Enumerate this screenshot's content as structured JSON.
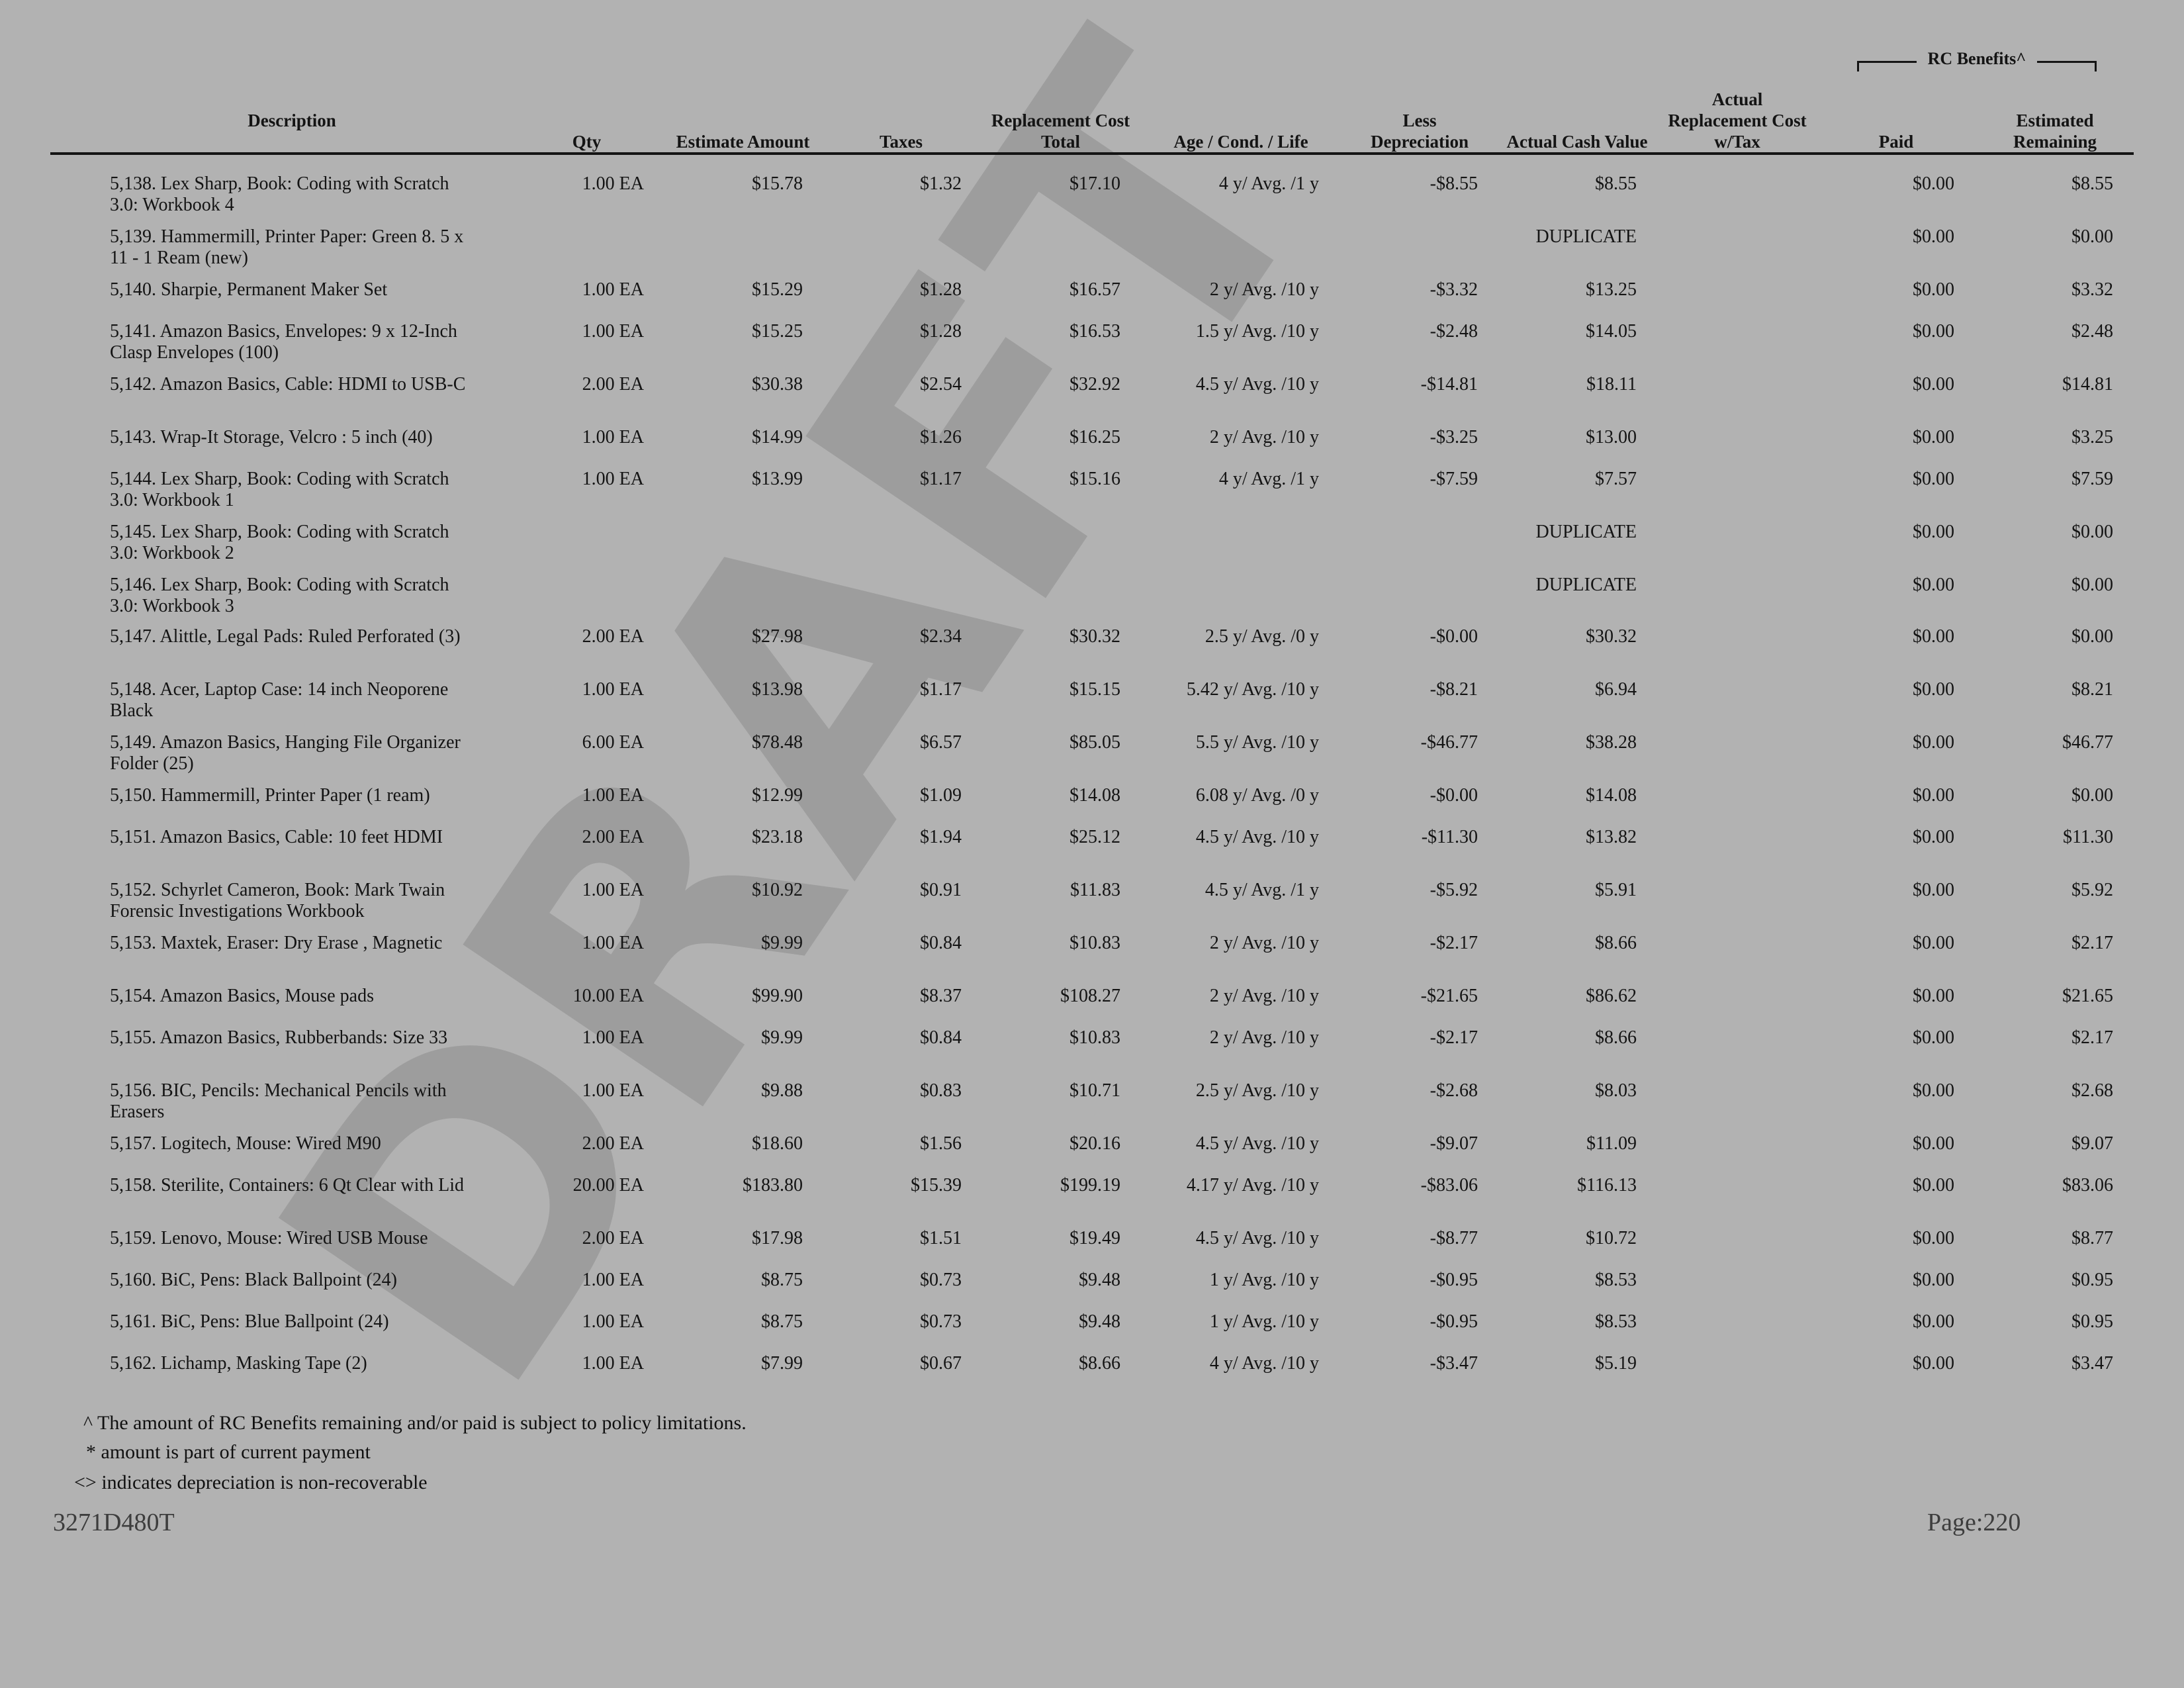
{
  "header": {
    "rc_benefits": "RC Benefits^",
    "description": "Description",
    "qty": "Qty",
    "estimate_amount": "Estimate Amount",
    "taxes": "Taxes",
    "rc_total_1": "Replacement Cost",
    "rc_total_2": "Total",
    "age_cond_life": "Age / Cond. / Life",
    "less_dep_1": "Less",
    "less_dep_2": "Depreciation",
    "acv": "Actual Cash Value",
    "arc_1": "Actual",
    "arc_2": "Replacement Cost",
    "arc_3": "w/Tax",
    "paid": "Paid",
    "est_rem_1": "Estimated",
    "est_rem_2": "Remaining"
  },
  "rows": [
    {
      "desc": "5,138. Lex Sharp, Book: Coding with Scratch 3.0: Workbook 4",
      "qty": "1.00 EA",
      "est": "$15.78",
      "tax": "$1.32",
      "rct": "$17.10",
      "age": "4 y/ Avg. /1 y",
      "dep": "-$8.55",
      "acv": "$8.55",
      "arc": "",
      "paid": "$0.00",
      "rem": "$8.55"
    },
    {
      "desc": "5,139. Hammermill, Printer Paper: Green 8. 5 x 11 - 1 Ream (new)",
      "qty": "",
      "est": "",
      "tax": "",
      "rct": "",
      "age": "",
      "dep": "",
      "acv": "DUPLICATE",
      "arc": "",
      "paid": "$0.00",
      "rem": "$0.00"
    },
    {
      "desc": "5,140. Sharpie, Permanent Maker Set",
      "qty": "1.00 EA",
      "est": "$15.29",
      "tax": "$1.28",
      "rct": "$16.57",
      "age": "2 y/ Avg. /10 y",
      "dep": "-$3.32",
      "acv": "$13.25",
      "arc": "",
      "paid": "$0.00",
      "rem": "$3.32"
    },
    {
      "desc": "5,141. Amazon Basics, Envelopes: 9 x 12-Inch Clasp Envelopes (100)",
      "qty": "1.00 EA",
      "est": "$15.25",
      "tax": "$1.28",
      "rct": "$16.53",
      "age": "1.5 y/ Avg. /10 y",
      "dep": "-$2.48",
      "acv": "$14.05",
      "arc": "",
      "paid": "$0.00",
      "rem": "$2.48"
    },
    {
      "desc": "5,142. Amazon Basics, Cable: HDMI to USB-C",
      "qty": "2.00 EA",
      "est": "$30.38",
      "tax": "$2.54",
      "rct": "$32.92",
      "age": "4.5 y/ Avg. /10 y",
      "dep": "-$14.81",
      "acv": "$18.11",
      "arc": "",
      "paid": "$0.00",
      "rem": "$14.81"
    },
    {
      "desc": "5,143. Wrap-It Storage, Velcro : 5 inch (40)",
      "qty": "1.00 EA",
      "est": "$14.99",
      "tax": "$1.26",
      "rct": "$16.25",
      "age": "2 y/ Avg. /10 y",
      "dep": "-$3.25",
      "acv": "$13.00",
      "arc": "",
      "paid": "$0.00",
      "rem": "$3.25"
    },
    {
      "desc": "5,144. Lex Sharp, Book: Coding with Scratch 3.0: Workbook 1",
      "qty": "1.00 EA",
      "est": "$13.99",
      "tax": "$1.17",
      "rct": "$15.16",
      "age": "4 y/ Avg. /1 y",
      "dep": "-$7.59",
      "acv": "$7.57",
      "arc": "",
      "paid": "$0.00",
      "rem": "$7.59"
    },
    {
      "desc": "5,145. Lex Sharp, Book: Coding with Scratch 3.0: Workbook 2",
      "qty": "",
      "est": "",
      "tax": "",
      "rct": "",
      "age": "",
      "dep": "",
      "acv": "DUPLICATE",
      "arc": "",
      "paid": "$0.00",
      "rem": "$0.00"
    },
    {
      "desc": "5,146. Lex Sharp, Book: Coding with Scratch 3.0: Workbook 3",
      "qty": "",
      "est": "",
      "tax": "",
      "rct": "",
      "age": "",
      "dep": "",
      "acv": "DUPLICATE",
      "arc": "",
      "paid": "$0.00",
      "rem": "$0.00"
    },
    {
      "desc": "5,147. Alittle, Legal Pads: Ruled Perforated (3)",
      "qty": "2.00 EA",
      "est": "$27.98",
      "tax": "$2.34",
      "rct": "$30.32",
      "age": "2.5 y/ Avg. /0 y",
      "dep": "-$0.00",
      "acv": "$30.32",
      "arc": "",
      "paid": "$0.00",
      "rem": "$0.00"
    },
    {
      "desc": "5,148. Acer, Laptop Case: 14 inch Neoporene Black",
      "qty": "1.00 EA",
      "est": "$13.98",
      "tax": "$1.17",
      "rct": "$15.15",
      "age": "5.42 y/ Avg. /10 y",
      "dep": "-$8.21",
      "acv": "$6.94",
      "arc": "",
      "paid": "$0.00",
      "rem": "$8.21"
    },
    {
      "desc": "5,149. Amazon Basics, Hanging File Organizer Folder (25)",
      "qty": "6.00 EA",
      "est": "$78.48",
      "tax": "$6.57",
      "rct": "$85.05",
      "age": "5.5 y/ Avg. /10 y",
      "dep": "-$46.77",
      "acv": "$38.28",
      "arc": "",
      "paid": "$0.00",
      "rem": "$46.77"
    },
    {
      "desc": "5,150. Hammermill, Printer Paper (1 ream)",
      "qty": "1.00 EA",
      "est": "$12.99",
      "tax": "$1.09",
      "rct": "$14.08",
      "age": "6.08 y/ Avg. /0 y",
      "dep": "-$0.00",
      "acv": "$14.08",
      "arc": "",
      "paid": "$0.00",
      "rem": "$0.00"
    },
    {
      "desc": "5,151. Amazon Basics, Cable: 10 feet HDMI",
      "qty": "2.00 EA",
      "est": "$23.18",
      "tax": "$1.94",
      "rct": "$25.12",
      "age": "4.5 y/ Avg. /10 y",
      "dep": "-$11.30",
      "acv": "$13.82",
      "arc": "",
      "paid": "$0.00",
      "rem": "$11.30"
    },
    {
      "desc": "5,152. Schyrlet Cameron, Book: Mark Twain Forensic Investigations Workbook",
      "qty": "1.00 EA",
      "est": "$10.92",
      "tax": "$0.91",
      "rct": "$11.83",
      "age": "4.5 y/ Avg. /1 y",
      "dep": "-$5.92",
      "acv": "$5.91",
      "arc": "",
      "paid": "$0.00",
      "rem": "$5.92"
    },
    {
      "desc": "5,153. Maxtek, Eraser: Dry Erase , Magnetic",
      "qty": "1.00 EA",
      "est": "$9.99",
      "tax": "$0.84",
      "rct": "$10.83",
      "age": "2 y/ Avg. /10 y",
      "dep": "-$2.17",
      "acv": "$8.66",
      "arc": "",
      "paid": "$0.00",
      "rem": "$2.17"
    },
    {
      "desc": "5,154. Amazon Basics, Mouse pads",
      "qty": "10.00 EA",
      "est": "$99.90",
      "tax": "$8.37",
      "rct": "$108.27",
      "age": "2 y/ Avg. /10 y",
      "dep": "-$21.65",
      "acv": "$86.62",
      "arc": "",
      "paid": "$0.00",
      "rem": "$21.65"
    },
    {
      "desc": "5,155. Amazon Basics, Rubberbands: Size 33",
      "qty": "1.00 EA",
      "est": "$9.99",
      "tax": "$0.84",
      "rct": "$10.83",
      "age": "2 y/ Avg. /10 y",
      "dep": "-$2.17",
      "acv": "$8.66",
      "arc": "",
      "paid": "$0.00",
      "rem": "$2.17"
    },
    {
      "desc": "5,156. BIC, Pencils: Mechanical Pencils with Erasers",
      "qty": "1.00 EA",
      "est": "$9.88",
      "tax": "$0.83",
      "rct": "$10.71",
      "age": "2.5 y/ Avg. /10 y",
      "dep": "-$2.68",
      "acv": "$8.03",
      "arc": "",
      "paid": "$0.00",
      "rem": "$2.68"
    },
    {
      "desc": "5,157. Logitech, Mouse: Wired M90",
      "qty": "2.00 EA",
      "est": "$18.60",
      "tax": "$1.56",
      "rct": "$20.16",
      "age": "4.5 y/ Avg. /10 y",
      "dep": "-$9.07",
      "acv": "$11.09",
      "arc": "",
      "paid": "$0.00",
      "rem": "$9.07"
    },
    {
      "desc": "5,158. Sterilite, Containers: 6 Qt Clear with Lid",
      "qty": "20.00 EA",
      "est": "$183.80",
      "tax": "$15.39",
      "rct": "$199.19",
      "age": "4.17 y/ Avg. /10 y",
      "dep": "-$83.06",
      "acv": "$116.13",
      "arc": "",
      "paid": "$0.00",
      "rem": "$83.06"
    },
    {
      "desc": "5,159. Lenovo, Mouse: Wired USB Mouse",
      "qty": "2.00 EA",
      "est": "$17.98",
      "tax": "$1.51",
      "rct": "$19.49",
      "age": "4.5 y/ Avg. /10 y",
      "dep": "-$8.77",
      "acv": "$10.72",
      "arc": "",
      "paid": "$0.00",
      "rem": "$8.77"
    },
    {
      "desc": "5,160. BiC, Pens: Black Ballpoint (24)",
      "qty": "1.00 EA",
      "est": "$8.75",
      "tax": "$0.73",
      "rct": "$9.48",
      "age": "1 y/ Avg. /10 y",
      "dep": "-$0.95",
      "acv": "$8.53",
      "arc": "",
      "paid": "$0.00",
      "rem": "$0.95"
    },
    {
      "desc": "5,161. BiC, Pens: Blue Ballpoint (24)",
      "qty": "1.00 EA",
      "est": "$8.75",
      "tax": "$0.73",
      "rct": "$9.48",
      "age": "1 y/ Avg. /10 y",
      "dep": "-$0.95",
      "acv": "$8.53",
      "arc": "",
      "paid": "$0.00",
      "rem": "$0.95"
    },
    {
      "desc": "5,162. Lichamp, Masking Tape (2)",
      "qty": "1.00 EA",
      "est": "$7.99",
      "tax": "$0.67",
      "rct": "$8.66",
      "age": "4 y/ Avg. /10 y",
      "dep": "-$3.47",
      "acv": "$5.19",
      "arc": "",
      "paid": "$0.00",
      "rem": "$3.47"
    }
  ],
  "footnotes": {
    "rc_limit": "^ The amount of RC Benefits remaining and/or paid is subject to policy limitations.",
    "current_payment": "* amount is part of current payment",
    "non_recoverable": "<> indicates depreciation is non-recoverable"
  },
  "footer": {
    "doc_id": "3271D480T",
    "page": "Page:220"
  },
  "watermark": "DRAFT",
  "colors": {
    "background": "#b2b2b2",
    "text": "#141414",
    "watermark": "#8c8c8c",
    "footer_text": "#3d3d3d"
  }
}
